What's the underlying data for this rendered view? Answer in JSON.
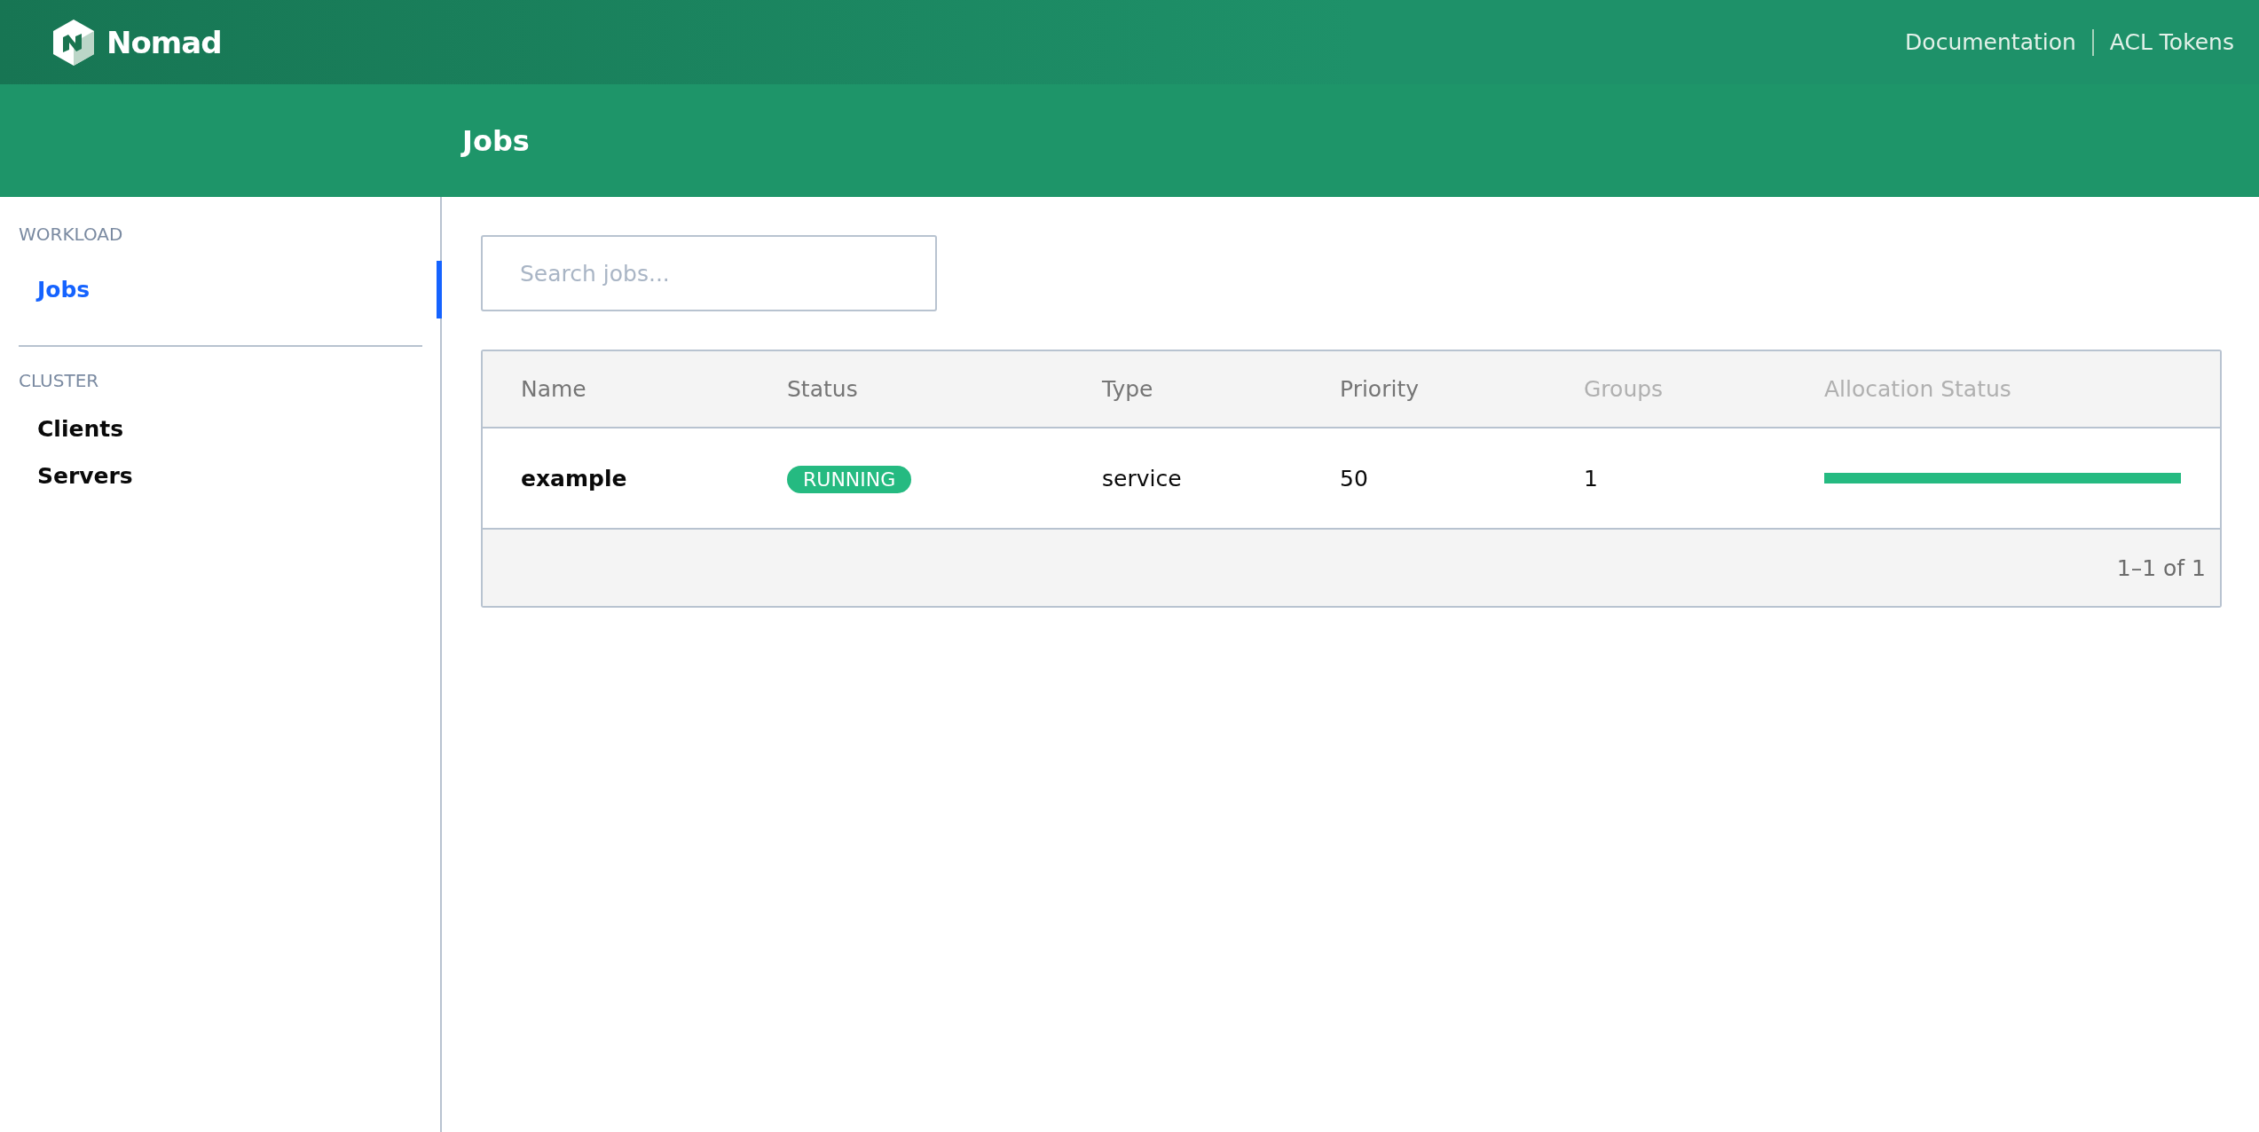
{
  "navbar": {
    "brand": "Nomad",
    "links": [
      "Documentation",
      "ACL Tokens"
    ]
  },
  "page_title": "Jobs",
  "sidebar": {
    "sections": [
      {
        "heading": "WORKLOAD",
        "items": [
          {
            "label": "Jobs",
            "selected": true
          }
        ]
      },
      {
        "heading": "CLUSTER",
        "items": [
          {
            "label": "Clients",
            "selected": false
          },
          {
            "label": "Servers",
            "selected": false
          }
        ]
      }
    ]
  },
  "search": {
    "placeholder": "Search jobs..."
  },
  "table": {
    "columns": [
      {
        "label": "Name",
        "sortable": true
      },
      {
        "label": "Status",
        "sortable": true
      },
      {
        "label": "Type",
        "sortable": true
      },
      {
        "label": "Priority",
        "sortable": true
      },
      {
        "label": "Groups",
        "sortable": false
      },
      {
        "label": "Allocation Status",
        "sortable": false
      }
    ],
    "rows": [
      {
        "name": "example",
        "status": "RUNNING",
        "type": "service",
        "priority": "50",
        "groups": "1",
        "allocation": {
          "level": 1
        }
      }
    ]
  },
  "pagination": "1–1 of 1"
}
